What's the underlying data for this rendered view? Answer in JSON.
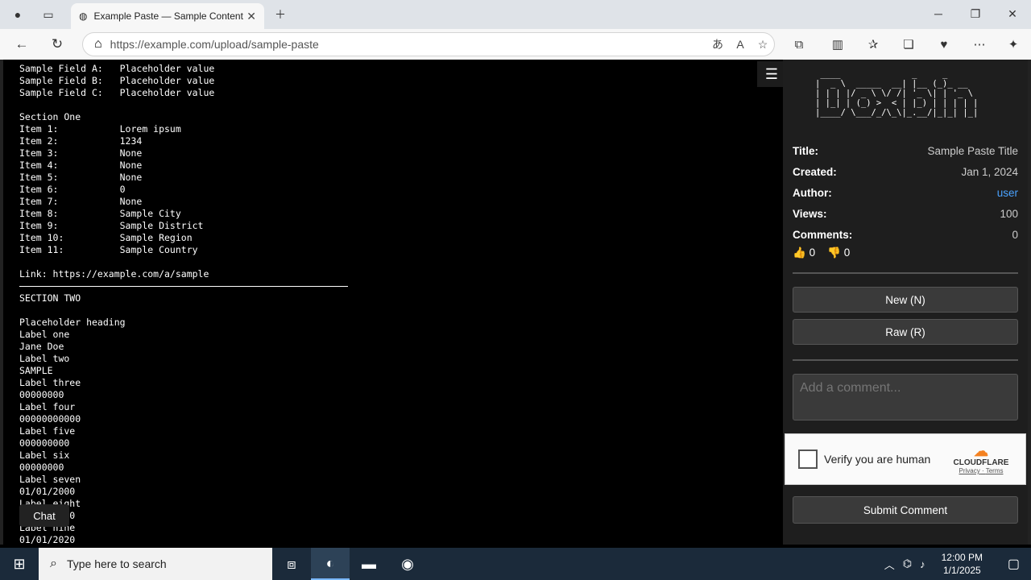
{
  "browser": {
    "tab_title": "Example Paste — Sample Content",
    "url": "https://example.com/upload/sample-paste"
  },
  "paste": {
    "lines_top": [
      "Sample Field A:   Placeholder value",
      "Sample Field B:   Placeholder value",
      "Sample Field C:   Placeholder value",
      "",
      "Section One",
      "Item 1:           Lorem ipsum",
      "Item 2:           1234",
      "Item 3:           None",
      "Item 4:           None",
      "Item 5:           None",
      "Item 6:           0",
      "Item 7:           None",
      "Item 8:           Sample City",
      "Item 9:           Sample District",
      "Item 10:          Sample Region",
      "Item 11:          Sample Country",
      "",
      "Link: https://example.com/a/sample"
    ],
    "lines_bottom": [
      "SECTION TWO",
      "",
      "Placeholder heading",
      "Label one",
      "Jane Doe",
      "Label two",
      "SAMPLE",
      "Label three",
      "00000000",
      "Label four",
      "00000000000",
      "Label five",
      "000000000",
      "Label six",
      "00000000",
      "Label seven",
      "01/01/2000",
      "Label eight",
      "01/01/2030",
      "Label nine",
      "01/01/2020"
    ]
  },
  "chat_label": "Chat",
  "sidebar": {
    "title_key": "Title:",
    "title_val": "Sample Paste Title",
    "created_key": "Created:",
    "created_val": "Jan 1, 2024",
    "author_key": "Author:",
    "author_val": "user",
    "views_key": "Views:",
    "views_val": "100",
    "comments_key": "Comments:",
    "comments_val": "0",
    "upvotes": "0",
    "downvotes": "0",
    "new_label": "New (N)",
    "raw_label": "Raw (R)",
    "comment_placeholder": "Add a comment...",
    "captcha_label": "Verify you are human",
    "cf_brand": "CLOUDFLARE",
    "cf_privacy": "Privacy",
    "cf_terms": "Terms",
    "submit_label": "Submit Comment"
  },
  "taskbar": {
    "search_placeholder": "Type here to search",
    "time": "12:00 PM",
    "date": "1/1/2025"
  }
}
